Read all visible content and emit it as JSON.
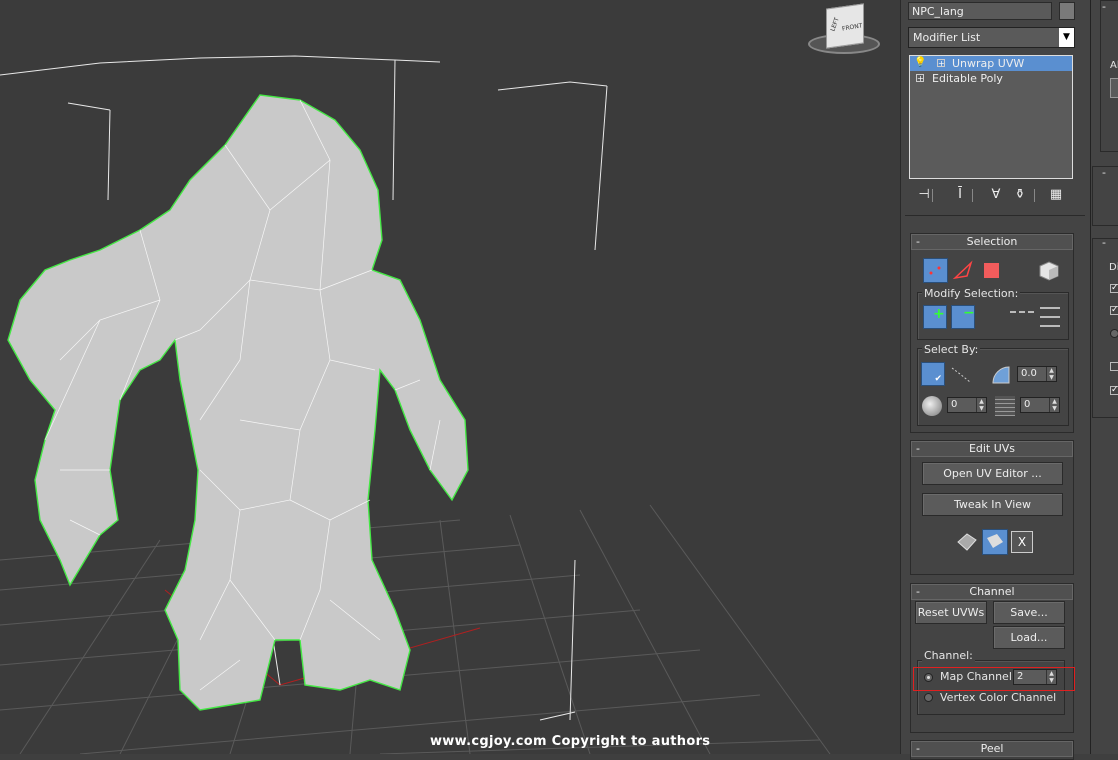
{
  "viewport": {
    "viewcube_label": "FRONT",
    "viewcube_side": "LEFT",
    "watermark": "www.cgjoy.com  Copyright to authors"
  },
  "object_name": "NPC_lang",
  "modifier_list": {
    "label": "Modifier List",
    "arrow": "▼"
  },
  "modifier_stack": [
    {
      "label": "Unwrap UVW",
      "selected": true,
      "icon": "lightbulb-icon"
    },
    {
      "label": "Editable Poly",
      "selected": false
    }
  ],
  "stack_tools": [
    "pin-stack-icon",
    "show-end-result-icon",
    "make-unique-icon",
    "remove-modifier-icon",
    "configure-modifier-sets-icon"
  ],
  "selection": {
    "title": "Selection",
    "collapse": "-",
    "modify_label": "Modify Selection:",
    "select_by_label": "Select By:",
    "angle_value": "0.0",
    "smooth_value": "0",
    "planar_value": "0"
  },
  "edit_uvs": {
    "title": "Edit UVs",
    "collapse": "-",
    "open_editor": "Open UV Editor ...",
    "tweak": "Tweak In View",
    "x_label": "X"
  },
  "channel": {
    "title": "Channel",
    "collapse": "-",
    "reset": "Reset UVWs",
    "save": "Save...",
    "load": "Load...",
    "group_label": "Channel:",
    "map_channel_label": "Map Channel:",
    "map_channel_value": "2",
    "vertex_color_label": "Vertex Color Channel"
  },
  "peel": {
    "title": "Peel",
    "collapse": "-"
  },
  "side_panel": {
    "label_a": "Al",
    "label_d": "Di",
    "minus": "-"
  },
  "colors": {
    "accent": "#5a8fd0",
    "highlight": "#e02020",
    "wire": "#45e845"
  }
}
